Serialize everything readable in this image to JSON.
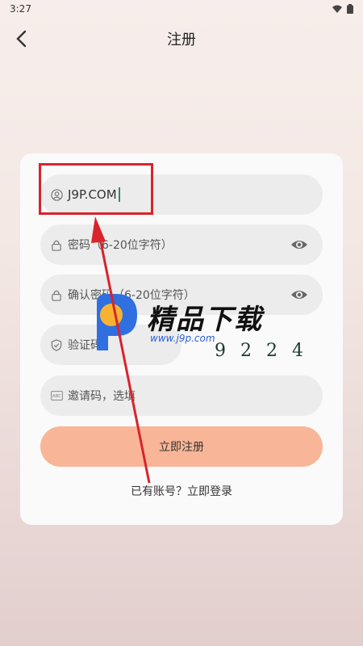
{
  "status": {
    "time": "3:27"
  },
  "header": {
    "title": "注册"
  },
  "form": {
    "username_value": "J9P.COM",
    "password_placeholder": "密码（6-20位字符）",
    "confirm_placeholder": "确认密码（6-20位字符）",
    "captcha_placeholder": "验证码",
    "invite_placeholder": "邀请码，选填",
    "submit_label": "立即注册",
    "login_link": "已有账号？立即登录"
  },
  "watermark": {
    "brand": "精品下载",
    "url": "www.j9p.com",
    "number": "9224"
  },
  "colors": {
    "submit_button": "#f9b597",
    "highlight": "#d9232d",
    "cursor": "#2a8b74"
  }
}
